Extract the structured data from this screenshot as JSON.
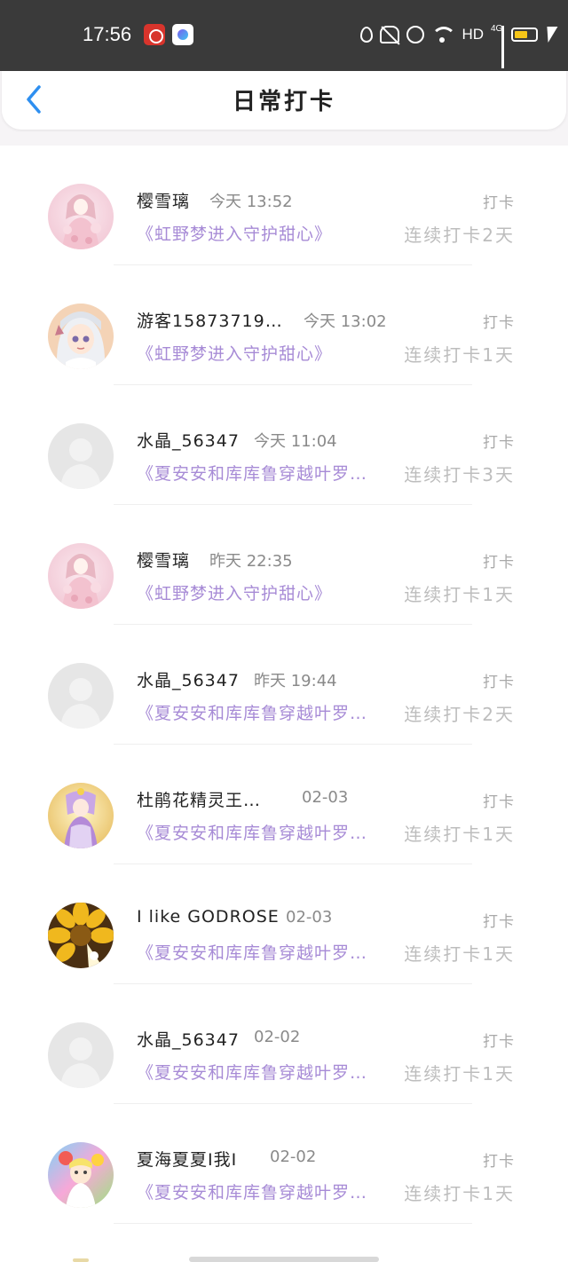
{
  "status_bar": {
    "time": "17:56",
    "icons": [
      "app-badge-red",
      "app-badge-gradient",
      "water-drop-icon",
      "mute-icon",
      "alarm-icon",
      "wifi-icon",
      "hd-icon",
      "signal-icon",
      "battery-icon",
      "charging-icon"
    ],
    "hd_label": "HD",
    "network_label": "4G",
    "battery_color": "#f5c518"
  },
  "header": {
    "back_icon": "chevron-left-icon",
    "title": "日常打卡",
    "accent_color": "#2e8ff0"
  },
  "checkins": [
    {
      "user": "樱雪璃",
      "time": "今天 13:52",
      "action": "打卡",
      "book": "《虹野梦进入守护甜心》",
      "streak": "连续打卡2天",
      "avatar": "anime-girl-pink"
    },
    {
      "user": "游客15873719…",
      "time": "今天 13:02",
      "action": "打卡",
      "book": "《虹野梦进入守护甜心》",
      "streak": "连续打卡1天",
      "avatar": "anime-girl-white-hair"
    },
    {
      "user": "水晶_56347",
      "time": "今天 11:04",
      "action": "打卡",
      "book": "《夏安安和库库鲁穿越叶罗…",
      "streak": "连续打卡3天",
      "avatar": "default-avatar"
    },
    {
      "user": "樱雪璃",
      "time": "昨天 22:35",
      "action": "打卡",
      "book": "《虹野梦进入守护甜心》",
      "streak": "连续打卡1天",
      "avatar": "anime-girl-pink"
    },
    {
      "user": "水晶_56347",
      "time": "昨天 19:44",
      "action": "打卡",
      "book": "《夏安安和库库鲁穿越叶罗…",
      "streak": "连续打卡2天",
      "avatar": "default-avatar"
    },
    {
      "user": "杜鹃花精灵王…",
      "time": "02-03",
      "action": "打卡",
      "book": "《夏安安和库库鲁穿越叶罗…",
      "streak": "连续打卡1天",
      "avatar": "fairy-purple"
    },
    {
      "user": "I like GODROSE",
      "time": "02-03",
      "action": "打卡",
      "book": "《夏安安和库库鲁穿越叶罗…",
      "streak": "连续打卡1天",
      "avatar": "yellow-flower"
    },
    {
      "user": "水晶_56347",
      "time": "02-02",
      "action": "打卡",
      "book": "《夏安安和库库鲁穿越叶罗…",
      "streak": "连续打卡1天",
      "avatar": "default-avatar"
    },
    {
      "user": "夏海夏夏I我I",
      "time": "02-02",
      "action": "打卡",
      "book": "《夏安安和库库鲁穿越叶罗…",
      "streak": "连续打卡1天",
      "avatar": "colorful-character"
    }
  ],
  "colors": {
    "book_title": "#a78bd6",
    "streak": "#bdbdbd",
    "time": "#8a8a8a",
    "username": "#222222"
  }
}
